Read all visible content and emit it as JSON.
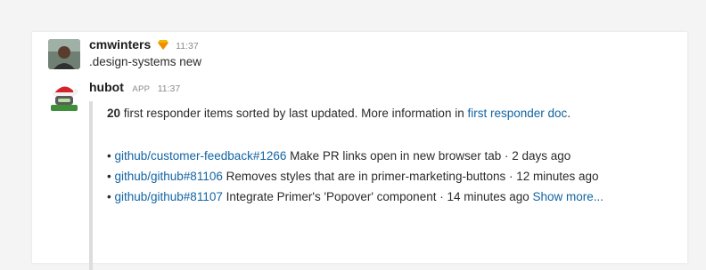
{
  "messages": [
    {
      "author": "cmwinters",
      "badge_icon": "gem-icon",
      "time": "11:37",
      "text": ".design-systems new"
    },
    {
      "author": "hubot",
      "app_label": "APP",
      "time": "11:37",
      "attachment": {
        "count": "20",
        "intro": " first responder items sorted by last updated. More information in ",
        "intro_link": "first responder doc",
        "intro_end": ".",
        "items": [
          {
            "bullet": "• ",
            "link": "github/customer-feedback#1266",
            "desc": " Make PR links open in new browser tab · 2 days ago",
            "more": ""
          },
          {
            "bullet": "• ",
            "link": "github/github#81106",
            "desc": " Removes styles that are in primer-marketing-buttons · 12 minutes ago",
            "more": ""
          },
          {
            "bullet": "• ",
            "link": "github/github#81107",
            "desc": " Integrate Primer's 'Popover' component · 14 minutes ago ",
            "more": "Show more..."
          }
        ]
      }
    }
  ],
  "colors": {
    "link": "#1264a3",
    "text": "#2b2b2b",
    "timestamp": "#8a8a8a",
    "attachment_bar": "#dddddd"
  }
}
